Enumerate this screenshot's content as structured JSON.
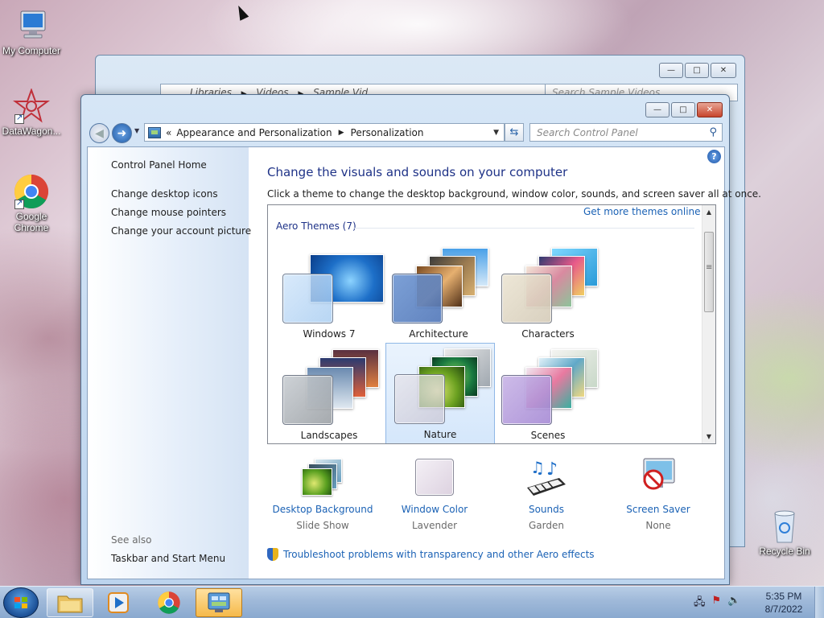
{
  "desktop": {
    "icons": [
      {
        "label": "My Computer"
      },
      {
        "label": "DataWagon..."
      },
      {
        "label": "Google Chrome"
      },
      {
        "label": "Recycle Bin"
      }
    ]
  },
  "background_window": {
    "breadcrumb": [
      "Libraries",
      "Videos",
      "Sample Vid..."
    ],
    "search_placeholder": "Search Sample Videos"
  },
  "window": {
    "breadcrumb_prefix": "«",
    "breadcrumb": [
      "Appearance and Personalization",
      "Personalization"
    ],
    "search_placeholder": "Search Control Panel",
    "caption": {
      "minimize": "—",
      "maximize": "□",
      "close": "✕"
    }
  },
  "sidebar": {
    "home": "Control Panel Home",
    "links": [
      "Change desktop icons",
      "Change mouse pointers",
      "Change your account picture"
    ],
    "see_also_label": "See also",
    "see_also_links": [
      "Taskbar and Start Menu"
    ]
  },
  "main": {
    "title": "Change the visuals and sounds on your computer",
    "description": "Click a theme to change the desktop background, window color, sounds, and screen saver all at once.",
    "more_themes": "Get more themes online",
    "group_heading": "Aero Themes (7)",
    "themes": [
      {
        "name": "Windows 7",
        "selected": false
      },
      {
        "name": "Architecture",
        "selected": false
      },
      {
        "name": "Characters",
        "selected": false
      },
      {
        "name": "Landscapes",
        "selected": false
      },
      {
        "name": "Nature",
        "selected": true
      },
      {
        "name": "Scenes",
        "selected": false
      }
    ],
    "settings": [
      {
        "name": "Desktop Background",
        "value": "Slide Show",
        "icon": "desktop-background-icon"
      },
      {
        "name": "Window Color",
        "value": "Lavender",
        "icon": "window-color-icon"
      },
      {
        "name": "Sounds",
        "value": "Garden",
        "icon": "sounds-icon"
      },
      {
        "name": "Screen Saver",
        "value": "None",
        "icon": "screen-saver-icon"
      }
    ],
    "troubleshoot": "Troubleshoot problems with transparency and other Aero effects"
  },
  "taskbar": {
    "time": "5:35 PM",
    "date": "8/7/2022",
    "accent": "#f5b94a"
  }
}
